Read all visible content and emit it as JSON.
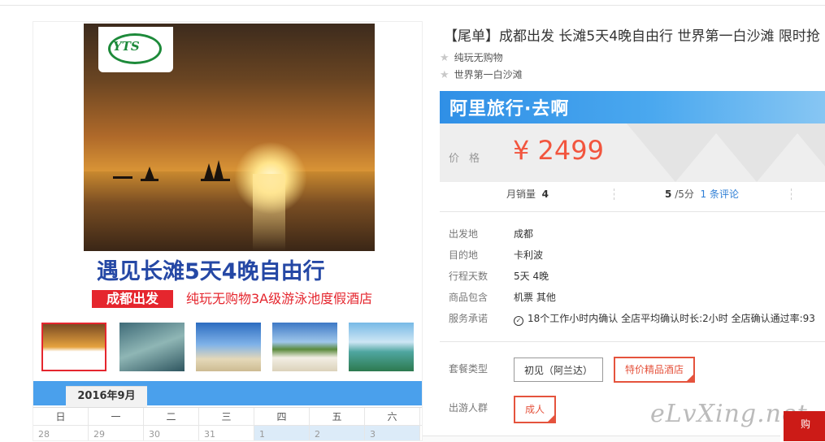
{
  "product": {
    "title": "【尾单】成都出发 长滩5天4晚自由行 世界第一白沙滩 限时抢",
    "features": [
      "纯玩无购物",
      "世界第一白沙滩"
    ]
  },
  "image": {
    "logo_text": "YTS",
    "headline": "遇见长滩5天4晚自由行",
    "tag": "成都出发",
    "subline": "纯玩无购物3A级游泳池度假酒店"
  },
  "calendar": {
    "month": "2016年9月",
    "weekdays": [
      "日",
      "一",
      "二",
      "三",
      "四",
      "五",
      "六"
    ],
    "dates": [
      "28",
      "29",
      "30",
      "31",
      "1",
      "2",
      "3"
    ]
  },
  "price_box": {
    "brand": "阿里旅行·去啊",
    "label": "价格",
    "price": "¥ 2499"
  },
  "stats": {
    "sales_label": "月销量",
    "sales_value": "4",
    "rating_value": "5",
    "rating_suffix": "/5分",
    "reviews": "1 条评论"
  },
  "info": [
    {
      "key": "出发地",
      "value": "成都"
    },
    {
      "key": "目的地",
      "value": "卡利波"
    },
    {
      "key": "行程天数",
      "value": "5天 4晚"
    },
    {
      "key": "商品包含",
      "value": "机票  其他"
    },
    {
      "key": "服务承诺",
      "value": "18个工作小时内确认    全店平均确认时长:2小时    全店确认通过率:93"
    }
  ],
  "package": {
    "type_label": "套餐类型",
    "options": [
      "初见（阿兰达）",
      "特价精品酒店"
    ],
    "traveler_label": "出游人群",
    "traveler_option": "成人"
  },
  "watermark": "eLvXing.net",
  "corner_text": "购"
}
